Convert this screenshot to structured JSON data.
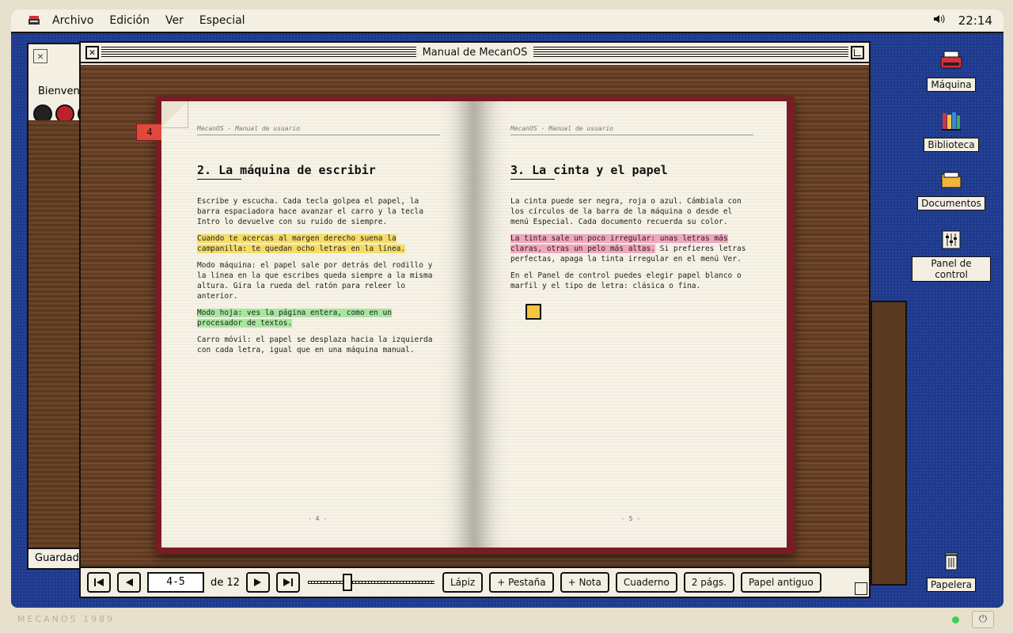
{
  "menubar": {
    "items": [
      "Archivo",
      "Edición",
      "Ver",
      "Especial"
    ],
    "clock": "22:14"
  },
  "desktop_icons": [
    {
      "label": "Máquina",
      "icon": "typewriter-icon"
    },
    {
      "label": "Biblioteca",
      "icon": "books-icon"
    },
    {
      "label": "Documentos",
      "icon": "folder-icon"
    },
    {
      "label": "Panel de control",
      "icon": "sliders-icon"
    },
    {
      "label": "Papelera",
      "icon": "trash-icon"
    }
  ],
  "bg_window": {
    "title": "Bienvenido",
    "save_label": "Guardado"
  },
  "window": {
    "title": "Manual de MecanOS"
  },
  "book": {
    "bookmark_tab": "4",
    "left": {
      "running_head": "MecanOS · Manual de usuario",
      "heading": "2. La máquina de escribir",
      "p1": "Escribe y escucha. Cada tecla golpea el papel, la barra espaciadora hace avanzar el carro y la tecla Intro lo devuelve con su ruido de siempre.",
      "p2": "Cuando te acercas al margen derecho suena la campanilla: te quedan ocho letras en la línea.",
      "p3": "Modo máquina: el papel sale por detrás del rodillo y la línea en la que escribes queda siempre a la misma altura. Gira la rueda del ratón para releer lo anterior.",
      "p4": "Modo hoja: ves la página entera, como en un procesador de textos.",
      "p5": "Carro móvil: el papel se desplaza hacia la izquierda con cada letra, igual que en una máquina manual.",
      "page_number": "- 4 -"
    },
    "right": {
      "running_head": "MecanOS · Manual de usuario",
      "heading": "3. La cinta y el papel",
      "p1": "La cinta puede ser negra, roja o azul. Cámbiala con los círculos de la barra de la máquina o desde el menú Especial. Cada documento recuerda su color.",
      "p2_highlight": "La tinta sale un poco irregular: unas letras más claras, otras un pelo más altas.",
      "p2_rest": " Si prefieres letras perfectas, apaga la tinta irregular en el menú Ver.",
      "p3": "En el Panel de control puedes elegir papel blanco o marfil y el tipo de letra: clásica o fina.",
      "page_number": "- 5 -"
    },
    "highlight_colors": {
      "yellow": "#f6dc66",
      "green": "#a8e6a0",
      "pink": "#f1a6c0"
    }
  },
  "toolbar": {
    "page_value": "4-5",
    "of_label": "de 12",
    "zoom_fraction": 0.3,
    "buttons": [
      "Lápiz",
      "+ Pestaña",
      "+ Nota",
      "Cuaderno",
      "2 págs.",
      "Papel antiguo"
    ]
  },
  "bezel": {
    "brand": "MECANOS 1989"
  }
}
